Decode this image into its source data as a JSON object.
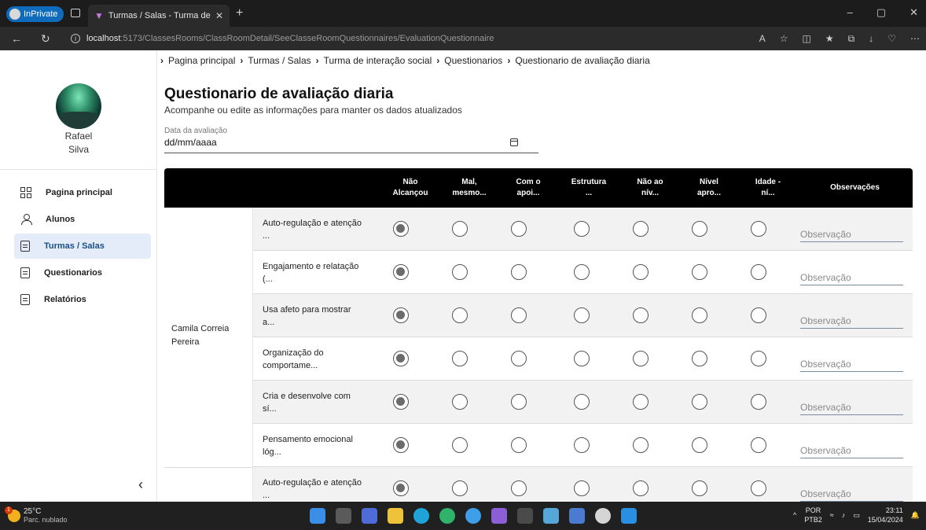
{
  "browser": {
    "inprivate_label": "InPrivate",
    "tab_title": "Turmas / Salas - Turma de interação",
    "url_host": "localhost",
    "url_path": ":5173/ClassesRooms/ClassRoomDetail/SeeClasseRoomQuestionnaires/EvaluationQuestionnaire"
  },
  "sidebar": {
    "user_first": "Rafael",
    "user_last": "Silva",
    "items": [
      {
        "label": "Pagina principal",
        "icon": "grid-icon"
      },
      {
        "label": "Alunos",
        "icon": "person-icon"
      },
      {
        "label": "Turmas / Salas",
        "icon": "document-icon",
        "active": true
      },
      {
        "label": "Questionarios",
        "icon": "document-icon"
      },
      {
        "label": "Relatórios",
        "icon": "document-icon"
      }
    ]
  },
  "breadcrumb": [
    "Pagina principal",
    "Turmas / Salas",
    "Turma de interação social",
    "Questionarios",
    "Questionario de avaliação diaria"
  ],
  "header": {
    "title": "Questionario de avaliação diaria",
    "subtitle": "Acompanhe ou edite as informações para manter os dados atualizados"
  },
  "date_field": {
    "label": "Data da avaliação",
    "value": "dd/mm/aaaa"
  },
  "table": {
    "columns": [
      [
        "Não",
        "Alcançou"
      ],
      [
        "Mal,",
        "mesmo..."
      ],
      [
        "Com o",
        "apoi..."
      ],
      [
        "Estrutura",
        "..."
      ],
      [
        "Não ao",
        "nív..."
      ],
      [
        "Nível",
        "apro..."
      ],
      [
        "Idade -",
        "ní..."
      ]
    ],
    "obs_header": "Observações",
    "student": [
      "Camila Correia",
      "Pereira"
    ],
    "rows": [
      {
        "q": [
          "Auto-regulação e atenção",
          "..."
        ],
        "selected": 0
      },
      {
        "q": [
          "Engajamento e relatação",
          "(..."
        ],
        "selected": 0
      },
      {
        "q": [
          "Usa afeto para mostrar",
          "a..."
        ],
        "selected": 0
      },
      {
        "q": [
          "Organização do",
          "comportame..."
        ],
        "selected": 0
      },
      {
        "q": [
          "Cria e desenvolve com",
          "sí..."
        ],
        "selected": 0
      },
      {
        "q": [
          "Pensamento emocional",
          "lóg..."
        ],
        "selected": 0
      },
      {
        "q": [
          "Auto-regulação e atenção",
          "..."
        ],
        "selected": 0
      }
    ],
    "obs_placeholder": "Observação"
  },
  "taskbar": {
    "temp": "25°C",
    "weather": "Parc. nublado",
    "weather_badge": "1",
    "lang1": "POR",
    "lang2": "PTB2",
    "time": "23:11",
    "date": "15/04/2024"
  }
}
